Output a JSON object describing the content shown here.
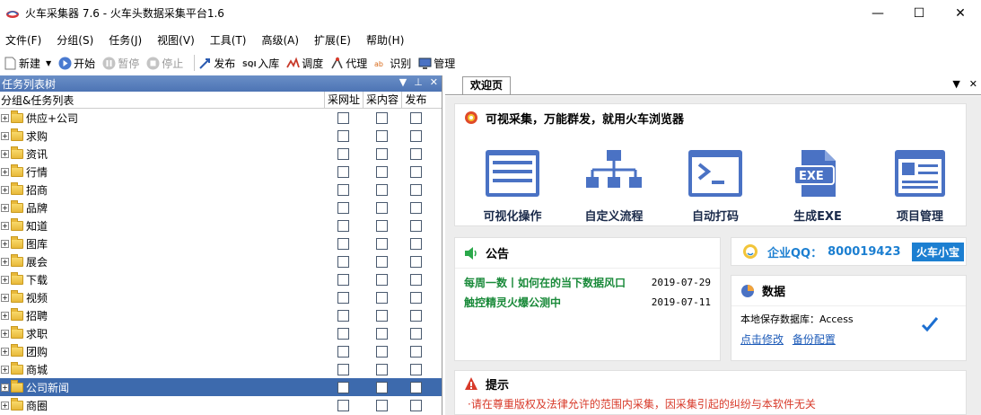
{
  "window": {
    "title": "火车采集器 7.6 - 火车头数据采集平台1.6",
    "minimize": "—",
    "maximize": "☐",
    "close": "✕"
  },
  "menu": [
    "文件(F)",
    "分组(S)",
    "任务(J)",
    "视图(V)",
    "工具(T)",
    "高级(A)",
    "扩展(E)",
    "帮助(H)"
  ],
  "toolbar": {
    "new": "新建",
    "start": "开始",
    "pause": "暂停",
    "stop": "停止",
    "publish": "发布",
    "import": "入库",
    "schedule": "调度",
    "proxy": "代理",
    "recognize": "识别",
    "manage": "管理"
  },
  "left_panel": {
    "title": "任务列表树",
    "col_group": "分组&任务列表",
    "col_url": "采网址",
    "col_content": "采内容",
    "col_publish": "发布",
    "items": [
      "供应+公司",
      "求购",
      "资讯",
      "行情",
      "招商",
      "品牌",
      "知道",
      "图库",
      "展会",
      "下载",
      "视频",
      "招聘",
      "求职",
      "团购",
      "商城",
      "公司新闻",
      "商圈"
    ],
    "selected_index": 15
  },
  "right_panel": {
    "tab": "欢迎页",
    "browser_card": {
      "title": "可视采集，万能群发，就用火车浏览器",
      "features": [
        "可视化操作",
        "自定义流程",
        "自动打码",
        "生成EXE",
        "项目管理"
      ]
    },
    "notice": {
      "title": "公告",
      "items": [
        {
          "text": "每周一数丨如何在的当下数据风口",
          "date": "2019-07-29"
        },
        {
          "text": "触控精灵火爆公测中",
          "date": "2019-07-11"
        }
      ]
    },
    "qq": {
      "label": "企业QQ：",
      "number": "800019423",
      "button": "火车小宝"
    },
    "data": {
      "title": "数据",
      "db_text": "本地保存数据库：Access",
      "edit_link": "点击修改",
      "backup_link": "备份配置"
    },
    "tip": {
      "title": "提示",
      "text": "·请在尊重版权及法律允许的范围内采集，因采集引起的纠纷与本软件无关"
    }
  },
  "colors": {
    "accent_blue": "#3d6aad",
    "icon_blue": "#4a72c4",
    "news_green": "#1a8a3a",
    "qq_blue": "#1c7fd1"
  }
}
